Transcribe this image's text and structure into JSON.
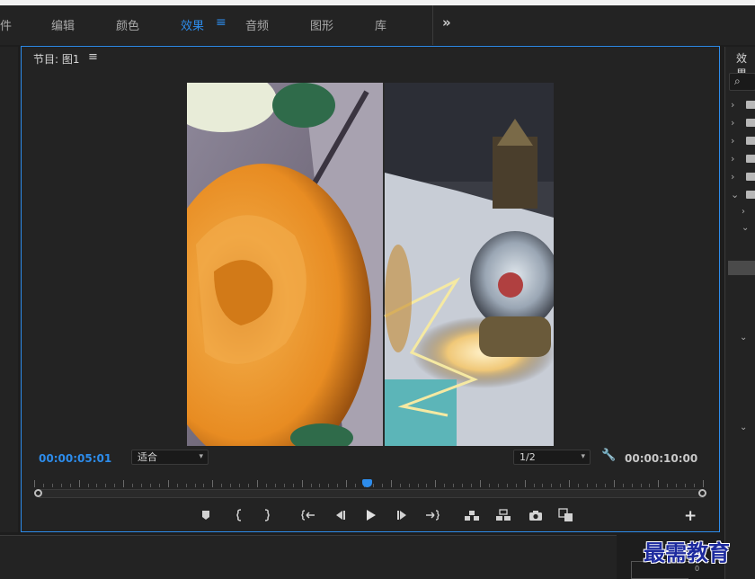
{
  "workspace": {
    "tabs": [
      {
        "label": "件"
      },
      {
        "label": "编辑"
      },
      {
        "label": "颜色"
      },
      {
        "label": "效果"
      },
      {
        "label": "音频"
      },
      {
        "label": "图形"
      },
      {
        "label": "库"
      }
    ],
    "active_tab": "效果",
    "menu_glyph": "≡",
    "more_glyph": "»",
    "accent_color": "#2d8ceb"
  },
  "program_monitor": {
    "title": "节目: 图1",
    "menu_glyph": "≡",
    "current_timecode": "00:00:05:01",
    "duration_timecode": "00:00:10:00",
    "zoom_select": {
      "value": "适合",
      "options_visible": [
        "适合"
      ]
    },
    "resolution_select": {
      "value": "1/2"
    },
    "playhead_fraction": 0.5,
    "transport_icons": [
      "marker-icon",
      "mark-in-icon",
      "mark-out-icon",
      "go-to-in-icon",
      "step-back-icon",
      "play-icon",
      "step-forward-icon",
      "go-to-out-icon",
      "lift-icon",
      "extract-icon",
      "export-frame-icon",
      "comparison-view-icon"
    ],
    "add_button_glyph": "+"
  },
  "effects_panel": {
    "title": "效果",
    "search_glyph": "⌕"
  },
  "audio_meter": {
    "label": "0"
  },
  "watermark": {
    "text": "最需教育"
  }
}
